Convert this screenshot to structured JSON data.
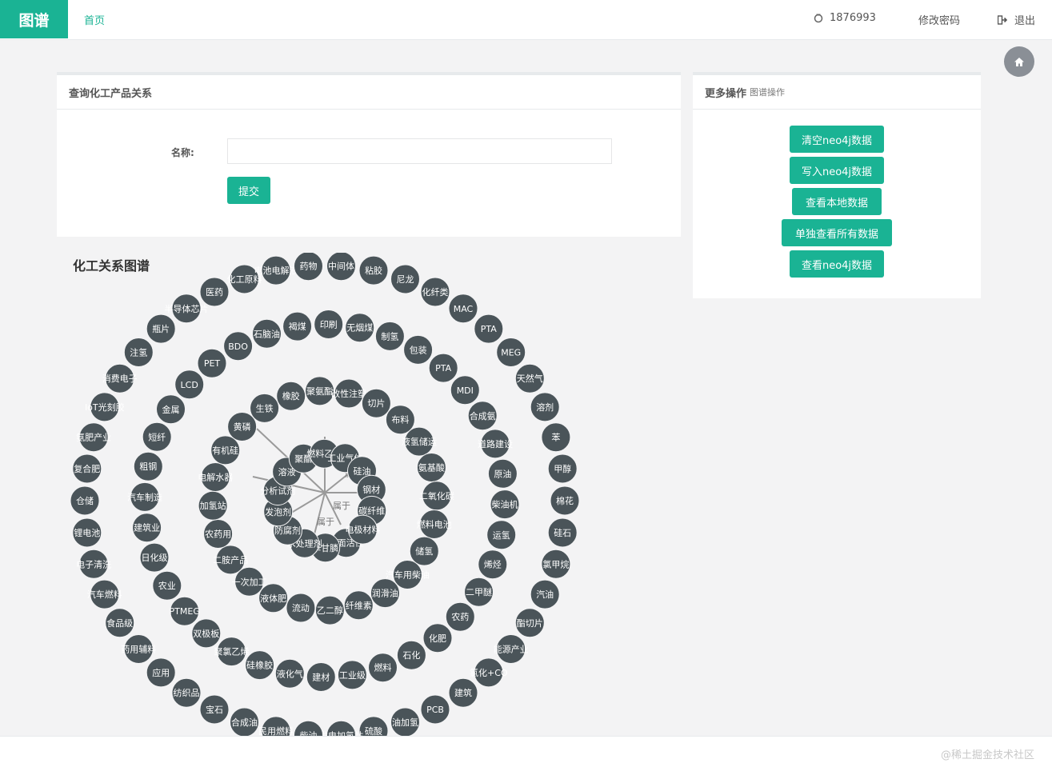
{
  "header": {
    "brand": "图谱",
    "home_label": "首页",
    "user_id": "1876993",
    "change_password": "修改密码",
    "logout": "退出"
  },
  "query_panel": {
    "title": "查询化工产品关系",
    "name_label": "名称:",
    "name_value": "",
    "submit_label": "提交"
  },
  "ops_panel": {
    "title": "更多操作",
    "subtitle": "图谱操作",
    "buttons": [
      "清空neo4j数据",
      "写入neo4j数据",
      "查看本地数据",
      "单独查看所有数据",
      "查看neo4j数据"
    ]
  },
  "graph": {
    "title": "化工关系图谱",
    "relation_label": "属于",
    "nodes": [
      "棉花",
      "硅石",
      "氯甲烷",
      "汽油",
      "酯切片",
      "能源产业",
      "氯化+CO",
      "建筑",
      "PCB",
      "油加氢",
      "硫酸",
      "发电加氢站",
      "柴油",
      "民用燃料",
      "合成油",
      "宝石",
      "纺织品",
      "应用",
      "药用辅料",
      "食品级",
      "汽车燃料",
      "电子清洗",
      "锂电池",
      "仓储",
      "复合肥",
      "氨肥产业",
      "IoT光刻胶",
      "消费电子",
      "注氢",
      "瓶片",
      "半导体芯片",
      "医药",
      "化工原料",
      "电池电解液",
      "药物",
      "中间体",
      "粘胶",
      "尼龙",
      "化纤类",
      "MAC",
      "PTA",
      "MEG",
      "天然气",
      "溶剂",
      "苯",
      "甲醇",
      "烯烃",
      "二甲醚",
      "农药",
      "化肥",
      "石化",
      "燃料",
      "工业级",
      "建材",
      "液化气",
      "硅橡胶",
      "聚氯乙烯",
      "双极板",
      "PTMEG",
      "农业",
      "日化级",
      "建筑业",
      "汽车制造",
      "粗钢",
      "短纤",
      "金属",
      "LCD",
      "PET",
      "BDO",
      "石脑油",
      "褐煤",
      "印刷",
      "无烟煤",
      "制氢",
      "包装",
      "PTA",
      "MDI",
      "合成氨",
      "道路建设",
      "原油",
      "柴油机",
      "运氢",
      "汽车用柴油",
      "润滑油",
      "纤维素",
      "乙二醇",
      "流动",
      "液体肥",
      "一次加工",
      "二胺产品",
      "农药用",
      "加氢站",
      "电解水器",
      "有机硅",
      "黄磷",
      "生铁",
      "橡胶",
      "聚氨酯",
      "改性注塑",
      "切片",
      "布料",
      "液氢储运",
      "氨基酸",
      "二氧化碳",
      "燃料电池",
      "储氢",
      "表面活性",
      "草甘膦",
      "水处理剂",
      "防腐剂",
      "发泡剂",
      "分析试剂",
      "溶液",
      "聚酯",
      "燃料乙醇",
      "工业气体",
      "硅油",
      "钢材",
      "碳纤维",
      "电极材料"
    ]
  }
}
